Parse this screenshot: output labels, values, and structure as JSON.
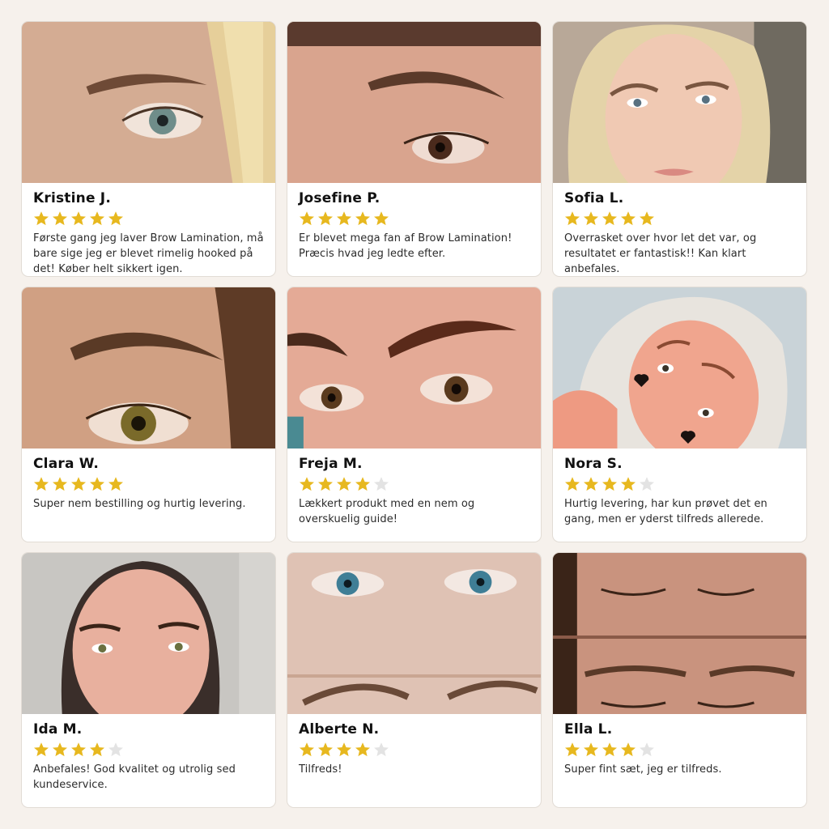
{
  "colors": {
    "star_filled": "#e7b81f",
    "star_empty": "#e3e3e3",
    "background": "#f6f1ec"
  },
  "reviews": [
    {
      "name": "Kristine J.",
      "rating": 5,
      "text": "Første gang jeg laver Brow Lamination, må bare sige jeg er blevet rimelig hooked på det! Køber helt sikkert igen.",
      "photo": "eye-closeup-blonde"
    },
    {
      "name": "Josefine P.",
      "rating": 5,
      "text": "Er blevet mega fan af Brow Lamination! Præcis hvad jeg ledte efter.",
      "photo": "brow-closeup"
    },
    {
      "name": "Sofia L.",
      "rating": 5,
      "text": "Overrasket over hvor let det var, og resultatet er fantastisk!! Kan klart anbefales.",
      "photo": "face-blonde"
    },
    {
      "name": "Clara W.",
      "rating": 5,
      "text": "Super nem bestilling og hurtig levering.",
      "photo": "eye-closeup-brown"
    },
    {
      "name": "Freja M.",
      "rating": 4,
      "text": "Lækkert produkt med en nem og overskuelig guide!",
      "photo": "eyes-closeup"
    },
    {
      "name": "Nora S.",
      "rating": 4,
      "text": "Hurtig levering, har kun prøvet det en gang, men er yderst tilfreds allerede.",
      "photo": "selfie-hearts"
    },
    {
      "name": "Ida M.",
      "rating": 4,
      "text": "Anbefales! God kvalitet og utrolig sed kundeservice.",
      "photo": "face-dark-hair"
    },
    {
      "name": "Alberte N.",
      "rating": 4,
      "text": "Tilfreds!",
      "photo": "blue-eyes-before-after"
    },
    {
      "name": "Ella L.",
      "rating": 4,
      "text": "Super fint sæt, jeg er tilfreds.",
      "photo": "closed-eyes-before-after"
    }
  ]
}
